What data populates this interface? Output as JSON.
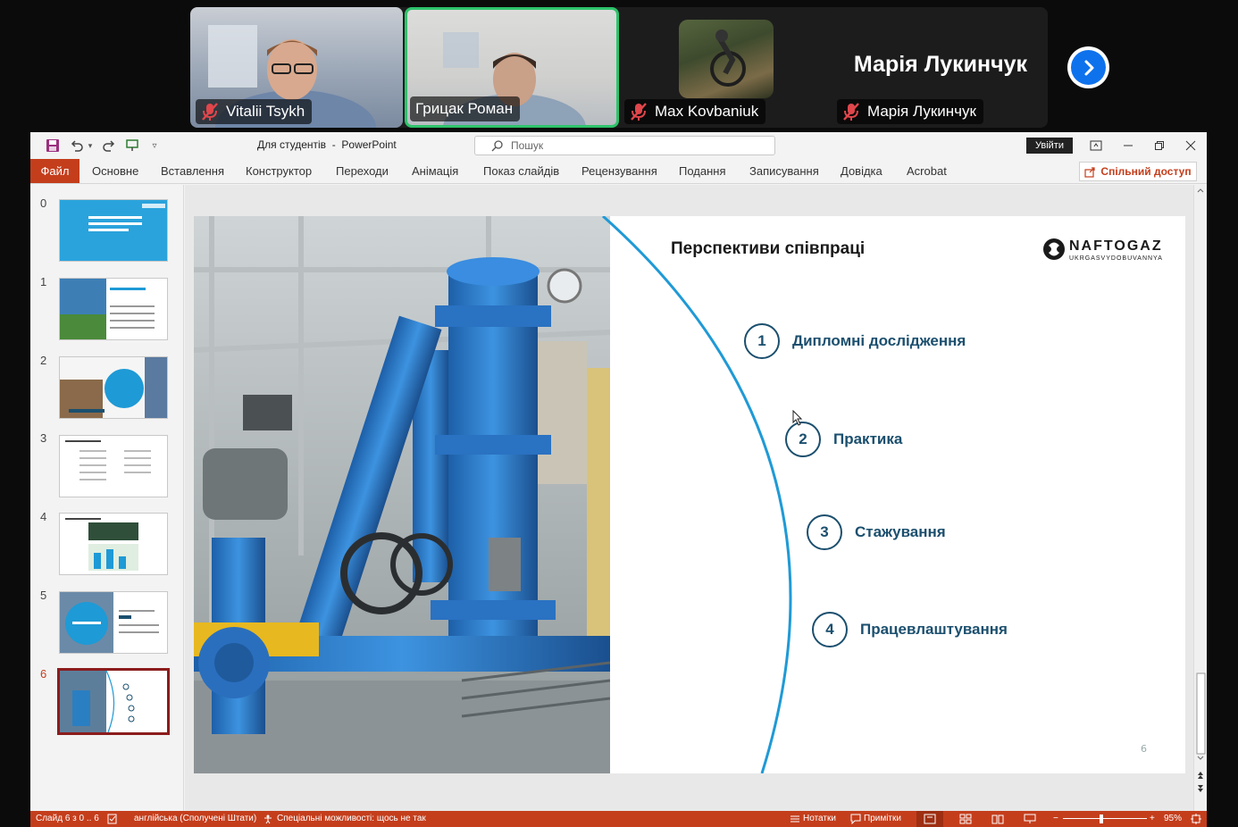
{
  "participants": [
    {
      "name": "Vitalii Tsykh",
      "muted": true
    },
    {
      "name": "Грицак Роман",
      "muted": false,
      "active_speaker": true
    },
    {
      "name": "Max Kovbaniuk",
      "muted": true
    },
    {
      "name": "Марія Лукинчук",
      "muted": true,
      "display_name_large": "Марія Лукинчук"
    }
  ],
  "colors": {
    "accent": "#c43e1c",
    "speaker_border": "#2ec36b",
    "slide_text": "#1b4f6e",
    "arc": "#1f9ad6",
    "zoom_blue": "#0e72ed"
  },
  "titlebar": {
    "doc_title": "Для студентів",
    "separator": "-",
    "app_name": "PowerPoint",
    "search_placeholder": "Пошук",
    "signin_label": "Увійти"
  },
  "ribbon": {
    "tabs": [
      "Файл",
      "Основне",
      "Вставлення",
      "Конструктор",
      "Переходи",
      "Анімація",
      "Показ слайдів",
      "Рецензування",
      "Подання",
      "Записування",
      "Довідка",
      "Acrobat"
    ],
    "share_label": "Спільний доступ"
  },
  "thumbnails": {
    "numbers": [
      "0",
      "1",
      "2",
      "3",
      "4",
      "5",
      "6"
    ],
    "active_index": 6
  },
  "slide": {
    "title": "Перспективи співпраці",
    "logo_text": "NAFTOGAZ",
    "logo_subtext": "UKRGASVYDOBUVANNYA",
    "items": [
      {
        "num": "1",
        "label": "Дипломні дослідження"
      },
      {
        "num": "2",
        "label": "Практика"
      },
      {
        "num": "3",
        "label": "Стажування"
      },
      {
        "num": "4",
        "label": "Працевлаштування"
      }
    ],
    "page_number": "6"
  },
  "statusbar": {
    "slide_info": "Слайд 6 з 0 .. 6",
    "language": "англійська (Сполучені Штати)",
    "accessibility": "Спеціальні можливості: щось не так",
    "notes_label": "Нотатки",
    "comments_label": "Примітки",
    "zoom": "95%"
  }
}
